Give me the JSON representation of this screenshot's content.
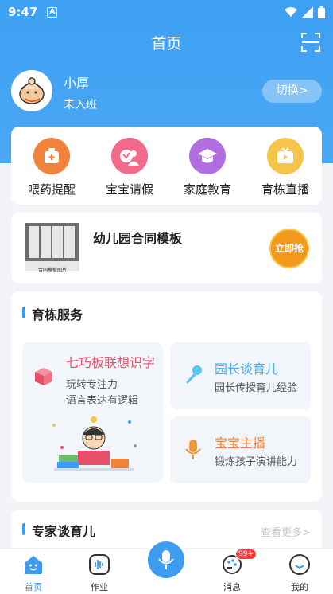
{
  "status_bar": {
    "time": "9:47",
    "notification": "A"
  },
  "header": {
    "title": "首页"
  },
  "user": {
    "name": "小厚",
    "class_status": "未入班",
    "switch_label": "切换>"
  },
  "quick_actions": [
    {
      "label": "喂药提醒",
      "icon": "medicine-kit-icon",
      "color": "#f0823c"
    },
    {
      "label": "宝宝请假",
      "icon": "leave-request-icon",
      "color": "#f26a8a"
    },
    {
      "label": "家庭教育",
      "icon": "graduation-cap-icon",
      "color": "#b06ee0"
    },
    {
      "label": "育栋直播",
      "icon": "tv-live-icon",
      "color": "#f5c54a"
    }
  ],
  "promo": {
    "title": "幼儿园合同模板",
    "image_caption": "合同模板图片",
    "badge": "立即抢"
  },
  "services": {
    "title": "育栋服务",
    "big": {
      "title": "七巧板联想识字",
      "sub1": "玩转专注力",
      "sub2": "语言表达有逻辑"
    },
    "small": [
      {
        "title": "园长谈育儿",
        "sub": "园长传授育儿经验"
      },
      {
        "title": "宝宝主播",
        "sub": "锻炼孩子演讲能力"
      }
    ]
  },
  "expert": {
    "title": "专家谈育儿",
    "more": "查看更多>"
  },
  "tabbar": {
    "home": "首页",
    "homework": "作业",
    "messages": "消息",
    "messages_badge": "99+",
    "mine": "我的"
  }
}
